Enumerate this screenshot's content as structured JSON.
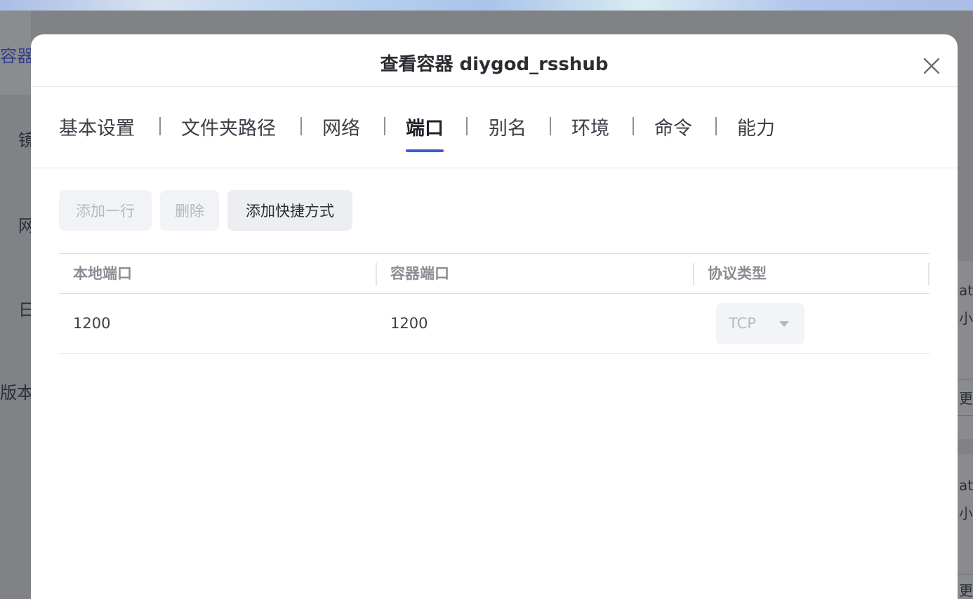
{
  "background": {
    "sidebar_labels": [
      "容器",
      "镜",
      "网",
      "日",
      "版本"
    ],
    "right_snippets": [
      "ate",
      "小",
      "更多",
      "ate",
      "小",
      "更多"
    ]
  },
  "dialog": {
    "title": "查看容器 diygod_rsshub",
    "close_icon": "close-icon"
  },
  "tabs": [
    {
      "label": "基本设置"
    },
    {
      "label": "文件夹路径"
    },
    {
      "label": "网络"
    },
    {
      "label": "端口",
      "active": true
    },
    {
      "label": "别名"
    },
    {
      "label": "环境"
    },
    {
      "label": "命令"
    },
    {
      "label": "能力"
    }
  ],
  "toolbar": {
    "add_row_label": "添加一行",
    "delete_label": "删除",
    "add_shortcut_label": "添加快捷方式"
  },
  "ports_table": {
    "columns": [
      "本地端口",
      "容器端口",
      "协议类型"
    ],
    "rows": [
      {
        "local_port": "1200",
        "container_port": "1200",
        "protocol": "TCP"
      }
    ]
  },
  "colors": {
    "accent": "#3a5bd0",
    "disabled_text": "#b6b9c0"
  }
}
